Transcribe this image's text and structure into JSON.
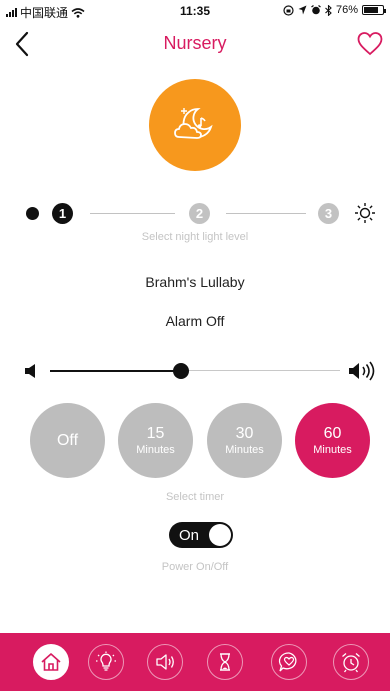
{
  "status_bar": {
    "carrier": "中国联通",
    "time": "11:35",
    "battery": "76%",
    "battery_level": 0.76
  },
  "header": {
    "title": "Nursery"
  },
  "light": {
    "levels": [
      "1",
      "2",
      "3"
    ],
    "active_level": "1",
    "hint": "Select night light level"
  },
  "sound": {
    "track": "Brahm's Lullaby",
    "alarm": "Alarm Off"
  },
  "volume": {
    "level": 0.45
  },
  "timer": {
    "options": [
      {
        "value": "Off",
        "unit": ""
      },
      {
        "value": "15",
        "unit": "Minutes"
      },
      {
        "value": "30",
        "unit": "Minutes"
      },
      {
        "value": "60",
        "unit": "Minutes"
      }
    ],
    "selected_index": 3,
    "hint": "Select timer"
  },
  "power": {
    "state": "On",
    "hint": "Power On/Off"
  },
  "tabs": [
    {
      "icon": "home-icon",
      "active": true
    },
    {
      "icon": "light-bulb-icon",
      "active": false
    },
    {
      "icon": "speaker-icon",
      "active": false
    },
    {
      "icon": "hourglass-icon",
      "active": false
    },
    {
      "icon": "heart-bubble-icon",
      "active": false
    },
    {
      "icon": "alarm-clock-icon",
      "active": false
    }
  ],
  "colors": {
    "accent": "#d81b60",
    "mode": "#f7981d",
    "inactive": "#bdbdbd"
  }
}
